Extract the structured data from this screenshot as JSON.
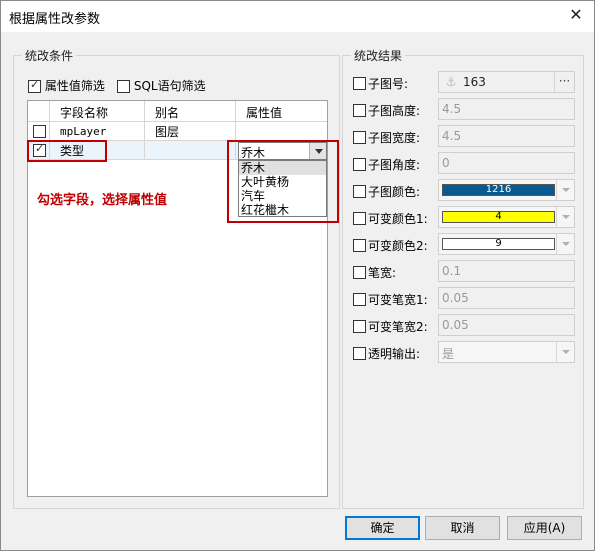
{
  "window": {
    "title": "根据属性改参数",
    "close_icon": "close-icon"
  },
  "left_group": {
    "legend": "统改条件",
    "attr_filter": {
      "label": "属性值筛选",
      "checked": true
    },
    "sql_filter": {
      "label": "SQL语句筛选",
      "checked": false
    },
    "table": {
      "headers": [
        "字段名称",
        "别名",
        "属性值"
      ],
      "rows": [
        {
          "checked": false,
          "field": "mpLayer",
          "alias": "图层",
          "value": ""
        },
        {
          "checked": true,
          "field": "类型",
          "alias": "",
          "value": "乔木"
        }
      ]
    },
    "dropdown_options": [
      "乔木",
      "大叶黄杨",
      "汽车",
      "红花檵木"
    ],
    "annotation": "勾选字段，选择属性值"
  },
  "right_group": {
    "legend": "统改结果",
    "params": [
      {
        "label": "子图号:",
        "value": "163",
        "kind": "symbol"
      },
      {
        "label": "子图高度:",
        "value": "4.5",
        "kind": "text"
      },
      {
        "label": "子图宽度:",
        "value": "4.5",
        "kind": "text"
      },
      {
        "label": "子图角度:",
        "value": "0",
        "kind": "text"
      },
      {
        "label": "子图颜色:",
        "value": "1216",
        "kind": "color",
        "color": "#0b5a8f",
        "text_color": "#ffffff"
      },
      {
        "label": "可变颜色1:",
        "value": "4",
        "kind": "color",
        "color": "#ffff00",
        "text_color": "#000000"
      },
      {
        "label": "可变颜色2:",
        "value": "9",
        "kind": "color",
        "color": "#ffffff",
        "text_color": "#000000"
      },
      {
        "label": "笔宽:",
        "value": "0.1",
        "kind": "text"
      },
      {
        "label": "可变笔宽1:",
        "value": "0.05",
        "kind": "text"
      },
      {
        "label": "可变笔宽2:",
        "value": "0.05",
        "kind": "text"
      },
      {
        "label": "透明输出:",
        "value": "是",
        "kind": "select"
      }
    ]
  },
  "buttons": {
    "ok": "确定",
    "cancel": "取消",
    "apply": "应用(A)"
  },
  "colors": {
    "annotation_red": "#c00000"
  }
}
